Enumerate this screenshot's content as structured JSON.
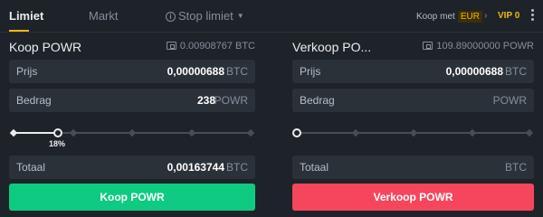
{
  "tabs": {
    "limit": "Limiet",
    "market": "Markt",
    "stop_limit": "Stop limiet"
  },
  "header": {
    "buy_with_label": "Koop met",
    "currency": "EUR",
    "vip": "VIP 0"
  },
  "buy": {
    "title": "Koop POWR",
    "balance": "0.00908767 BTC",
    "price_label": "Prijs",
    "price_value": "0,00000688",
    "price_unit": "BTC",
    "amount_label": "Bedrag",
    "amount_value": "238",
    "amount_unit": "POWR",
    "slider_percent": 18,
    "slider_label": "18%",
    "total_label": "Totaal",
    "total_value": "0,00163744",
    "total_unit": "BTC",
    "button": "Koop POWR",
    "color": "#0ecb81"
  },
  "sell": {
    "title": "Verkoop PO...",
    "balance": "109.89000000 POWR",
    "price_label": "Prijs",
    "price_value": "0,00000688",
    "price_unit": "BTC",
    "amount_label": "Bedrag",
    "amount_value": "",
    "amount_unit": "POWR",
    "slider_percent": 0,
    "total_label": "Totaal",
    "total_value": "",
    "total_unit": "BTC",
    "button": "Verkoop POWR",
    "color": "#f6465d"
  },
  "accent": "#f0b90b"
}
